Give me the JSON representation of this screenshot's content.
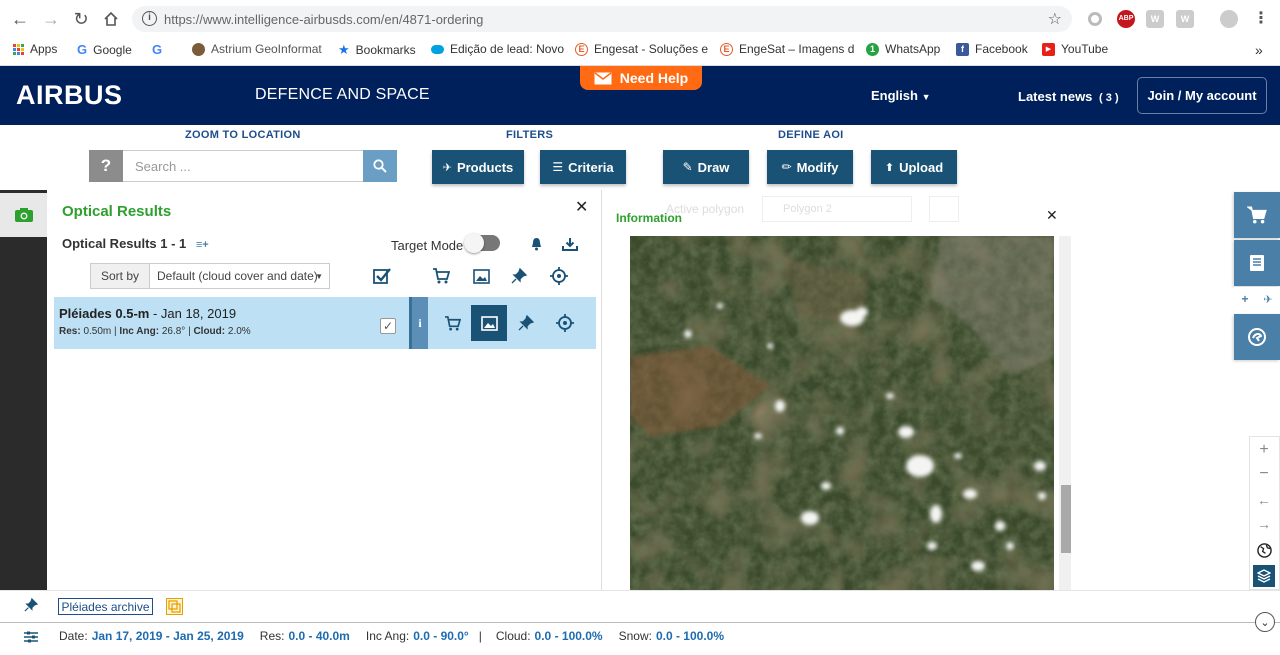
{
  "browser": {
    "url_prefix": "https://www.intelligence-airbusds.com",
    "url_path": "/en/4871-ordering",
    "extensions": [
      "ABP",
      "W",
      "W"
    ],
    "bookmarks": [
      {
        "label": "Apps",
        "icon": "apps-grid-icon",
        "color": "#4285f4"
      },
      {
        "label": "Google",
        "icon": "G",
        "color": "#4285f4"
      },
      {
        "label": "",
        "icon": "G",
        "color": "#4285f4"
      },
      {
        "label": "Astrium GeoInformat",
        "icon": "globe-icon",
        "color": "#7a5c3a"
      },
      {
        "label": "Bookmarks",
        "icon": "star-icon",
        "color": "#1a73e8"
      },
      {
        "label": "Edição de lead: Novo",
        "icon": "cloud-icon",
        "color": "#00a1e0"
      },
      {
        "label": "Engesat - Soluções e",
        "icon": "E",
        "color": "#e65c2a"
      },
      {
        "label": "EngeSat – Imagens d",
        "icon": "E",
        "color": "#e65c2a"
      },
      {
        "label": "WhatsApp",
        "icon": "1",
        "color": "#25a244"
      },
      {
        "label": "Facebook",
        "icon": "f",
        "color": "#3b5998"
      },
      {
        "label": "YouTube",
        "icon": "▶",
        "color": "#e62117"
      }
    ],
    "more": "»"
  },
  "header": {
    "logo": "AIRBUS",
    "tagline": "DEFENCE AND SPACE",
    "need_help": "Need Help",
    "language": "English",
    "latest_news": "Latest news",
    "news_count": "( 3 )",
    "account": "Join / My account"
  },
  "toolbar": {
    "zoom_title": "ZOOM TO LOCATION",
    "filters_title": "FILTERS",
    "aoi_title": "DEFINE AOI",
    "search_help": "?",
    "search_placeholder": "Search ...",
    "products": "Products",
    "criteria": "Criteria",
    "draw": "Draw",
    "modify": "Modify",
    "upload": "Upload"
  },
  "results": {
    "title": "Optical Results",
    "count_label": "Optical Results 1 - 1",
    "target_mode": "Target Mode",
    "sort_by": "Sort by",
    "sort_value": "Default (cloud cover and date)",
    "item": {
      "title_bold": "Pléiades 0.5-m",
      "title_rest": " - Jan 18, 2019",
      "res_label": "Res:",
      "res_value": " 0.50m | ",
      "inc_label": "Inc Ang:",
      "inc_value": "  26.8° | ",
      "cloud_label": "Cloud:",
      "cloud_value": " 2.0%",
      "info": "i"
    }
  },
  "preview": {
    "info_label": "Information",
    "ghost_active_polygon": "Active polygon",
    "ghost_polygon": "Polygon 2"
  },
  "bottom": {
    "archive": "Pléiades archive",
    "date_label": "Date:",
    "date_value": "Jan 17, 2019 - Jan 25, 2019",
    "res_label": "Res:",
    "res_value": "0.0 - 40.0m",
    "inc_label": "Inc Ang:",
    "inc_value": "0.0 - 90.0°",
    "sep": "|",
    "cloud_label": "Cloud:",
    "cloud_value": "0.0 - 100.0%",
    "snow_label": "Snow:",
    "snow_value": "0.0 - 100.0%"
  },
  "colors": {
    "airbus_navy": "#00205b",
    "help_orange": "#ff6a13",
    "button_blue": "#1a5276",
    "result_green": "#2ea02e",
    "row_highlight": "#bde0f5",
    "rail_blue": "#4a7fa8"
  }
}
